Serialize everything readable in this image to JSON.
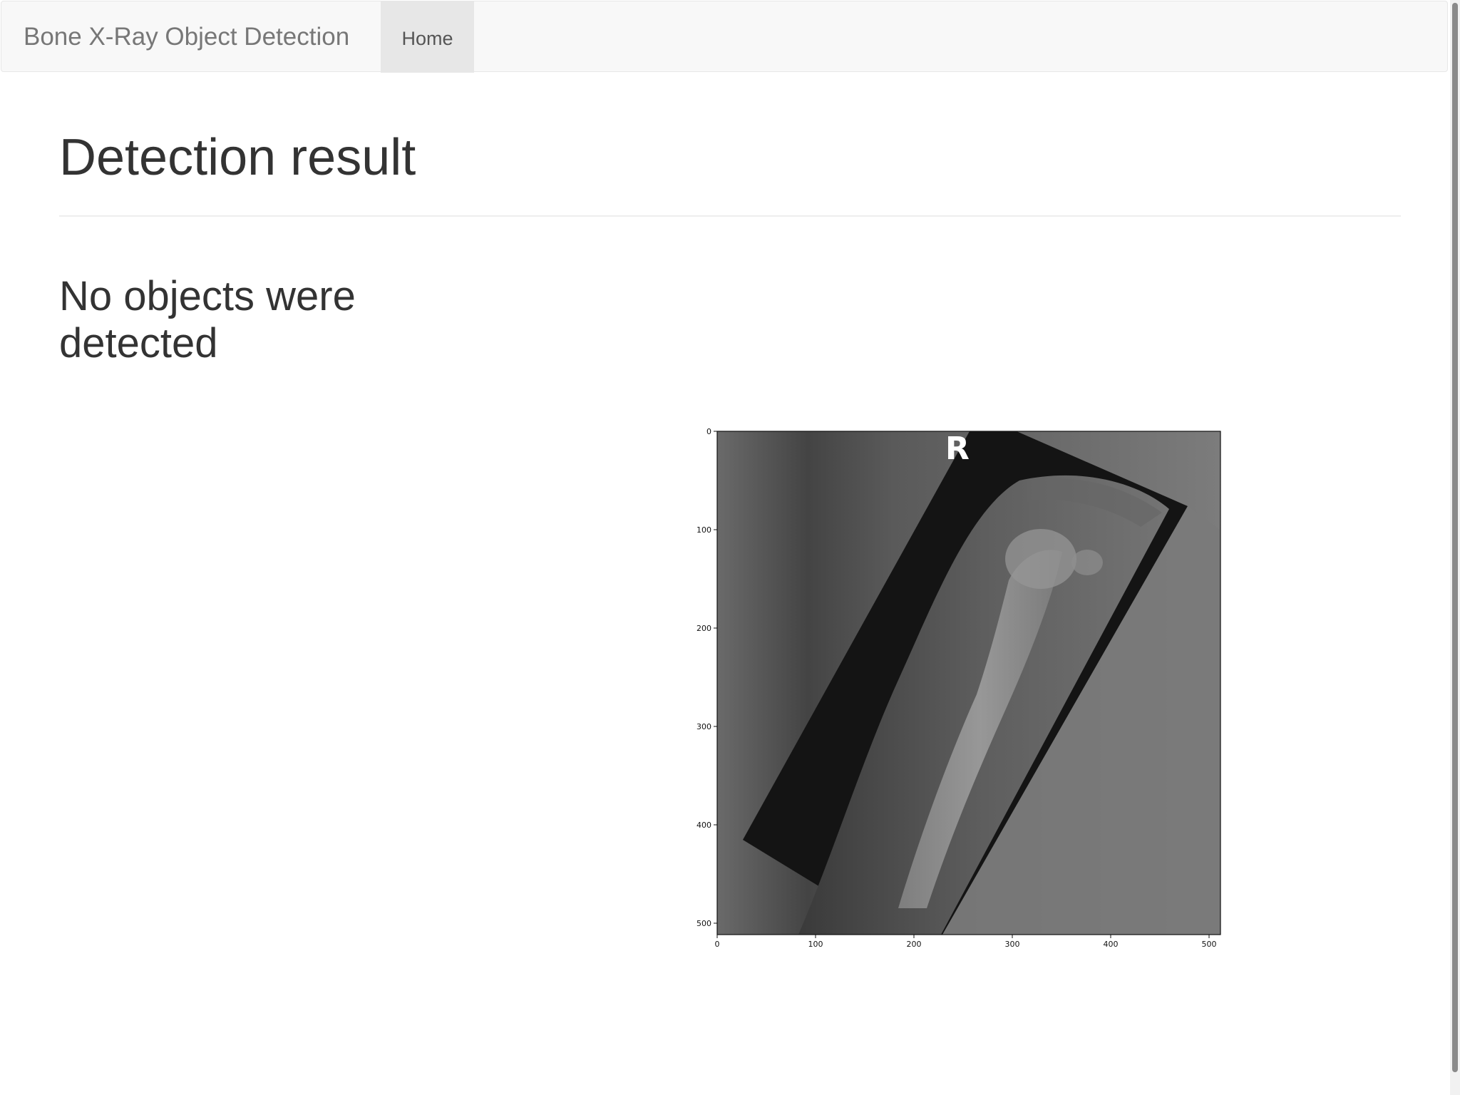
{
  "navbar": {
    "brand": "Bone X-Ray Object Detection",
    "home_label": "Home"
  },
  "page": {
    "title": "Detection result",
    "status": "No objects were detected"
  },
  "result_image": {
    "marker_letter": "R",
    "x_ticks": [
      "0",
      "100",
      "200",
      "300",
      "400",
      "500"
    ],
    "y_ticks": [
      "0",
      "100",
      "200",
      "300",
      "400",
      "500"
    ]
  }
}
